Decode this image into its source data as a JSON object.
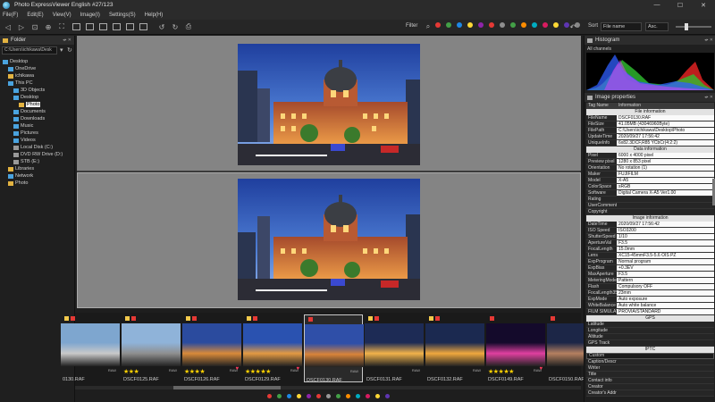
{
  "app": {
    "title": "Photo ExpressViewer English  #27/123",
    "window_buttons": [
      "—",
      "☐",
      "✕"
    ]
  },
  "menu": [
    "File(F)",
    "Edit(E)",
    "View(V)",
    "Image(I)",
    "Settings(S)",
    "Help(H)"
  ],
  "toolbar": {
    "filter_label": "Filter",
    "sort_label": "Sort",
    "sort_value": "File name",
    "order_value": "Asc.",
    "filter_dot_colors": [
      "#e53935",
      "#43a047",
      "#1e88e5",
      "#fdd835",
      "#8e24aa",
      "#e53935",
      "#8e8e8e",
      "#43a047",
      "#fb8c00",
      "#00acc1",
      "#d81b60",
      "#fdd835",
      "#5e35b1",
      "#888888"
    ]
  },
  "left_panel": {
    "title": "Folder",
    "path": "C:\\Users\\ichikawa\\Desk",
    "tree": [
      {
        "label": "Desktop",
        "indent": 0,
        "color": "#4aa3df"
      },
      {
        "label": "OneDrive",
        "indent": 1,
        "color": "#4aa3df"
      },
      {
        "label": "ichikawa",
        "indent": 1,
        "color": "#e3b341"
      },
      {
        "label": "This PC",
        "indent": 1,
        "color": "#4aa3df"
      },
      {
        "label": "3D Objects",
        "indent": 2,
        "color": "#4aa3df"
      },
      {
        "label": "Desktop",
        "indent": 2,
        "color": "#4aa3df"
      },
      {
        "label": "Photo",
        "indent": 3,
        "color": "#e3b341",
        "selected": true
      },
      {
        "label": "Documents",
        "indent": 2,
        "color": "#4aa3df"
      },
      {
        "label": "Downloads",
        "indent": 2,
        "color": "#4aa3df"
      },
      {
        "label": "Music",
        "indent": 2,
        "color": "#4aa3df"
      },
      {
        "label": "Pictures",
        "indent": 2,
        "color": "#4aa3df"
      },
      {
        "label": "Videos",
        "indent": 2,
        "color": "#4aa3df"
      },
      {
        "label": "Local Disk (C:)",
        "indent": 2,
        "color": "#999999"
      },
      {
        "label": "DVD RW Drive (D:)",
        "indent": 2,
        "color": "#999999"
      },
      {
        "label": "STB (E:)",
        "indent": 2,
        "color": "#999999"
      },
      {
        "label": "Libraries",
        "indent": 1,
        "color": "#e3b341"
      },
      {
        "label": "Network",
        "indent": 1,
        "color": "#4aa3df"
      },
      {
        "label": "Photo",
        "indent": 1,
        "color": "#e3b341"
      }
    ]
  },
  "filmstrip": [
    {
      "caption": "0130.RAF",
      "stars": 0,
      "raw": "RAW",
      "heart": false,
      "marks": [
        "#f2c94c",
        "#e53935"
      ],
      "selected": false,
      "scene": "day"
    },
    {
      "caption": "DSCF0125.RAF",
      "stars": 3,
      "raw": "RAW",
      "heart": false,
      "marks": [
        "#f2c94c",
        "#e53935"
      ],
      "selected": false,
      "scene": "city"
    },
    {
      "caption": "DSCF0126.RAF",
      "stars": 4,
      "raw": "RAW",
      "heart": true,
      "marks": [
        "#f2c94c",
        "#e53935"
      ],
      "selected": false,
      "scene": "dusk"
    },
    {
      "caption": "DSCF0129.RAF",
      "stars": 5,
      "raw": "RAW",
      "heart": true,
      "marks": [
        "#f2c94c",
        "#e53935"
      ],
      "selected": false,
      "scene": "dusk2"
    },
    {
      "caption": "DSCF0130.RAF",
      "stars": 0,
      "raw": "RAW",
      "heart": false,
      "marks": [
        "#e53935"
      ],
      "selected": true,
      "scene": "dusk3"
    },
    {
      "caption": "DSCF0131.RAF",
      "stars": 0,
      "raw": "RAW",
      "heart": false,
      "marks": [
        "#f2c94c",
        "#e53935"
      ],
      "selected": false,
      "scene": "night"
    },
    {
      "caption": "DSCF0132.RAF",
      "stars": 0,
      "raw": "RAW",
      "heart": false,
      "marks": [
        "#f2c94c",
        "#e53935"
      ],
      "selected": false,
      "scene": "night2"
    },
    {
      "caption": "DSCF0149.RAF",
      "stars": 5,
      "raw": "RAW",
      "heart": true,
      "marks": [
        "#e53935"
      ],
      "selected": false,
      "scene": "pink"
    },
    {
      "caption": "DSCF0150.RAF",
      "stars": 0,
      "raw": "RAW",
      "heart": false,
      "marks": [
        "#e53935"
      ],
      "selected": false,
      "scene": "street"
    }
  ],
  "status_dot_colors": [
    "#e53935",
    "#43a047",
    "#1e88e5",
    "#fdd835",
    "#8e24aa",
    "#e53935",
    "#999999",
    "#43a047",
    "#fb8c00",
    "#00acc1",
    "#d81b60",
    "#fdd835",
    "#5e35b1"
  ],
  "histogram": {
    "title": "Histogram",
    "subtitle": "All channels"
  },
  "properties": {
    "title": "Image properties",
    "col_tag": "Tag Name",
    "col_info": "Information",
    "sections": [
      {
        "title": "File information",
        "rows": [
          [
            "FileName",
            "DSCF0130.RAF"
          ],
          [
            "FileSize",
            "41.05MB (43046960Byte)"
          ],
          [
            "FilePath",
            "C:\\Users\\ichikawa\\Desktop\\Photo"
          ],
          [
            "UpdateTime",
            "2020/09/27 17:56:42"
          ],
          [
            "UniqueInfo",
            "6x82.3DCF,R85 YCbCr(4:2:2)"
          ]
        ]
      },
      {
        "title": "Data information",
        "rows": [
          [
            "Pixel",
            "6000 x 4000 pixel"
          ],
          [
            "Preview pixel",
            "1280 x 853 pixel"
          ],
          [
            "Orientation",
            "No rotation (1)"
          ],
          [
            "Maker",
            "FUJIFILM"
          ],
          [
            "Model",
            "X-A5"
          ],
          [
            "ColorSpace",
            "sRGB"
          ],
          [
            "Software",
            "Digital Camera X-A5 Ver1.00"
          ],
          [
            "Rating",
            ""
          ],
          [
            "UserComment",
            ""
          ],
          [
            "Copyright",
            ""
          ]
        ]
      },
      {
        "title": "Image information",
        "rows": [
          [
            "DateTime",
            "2020/09/27 17:56:42"
          ],
          [
            "ISO Speed",
            "ISO3200"
          ],
          [
            "ShutterSpeed",
            "1/10"
          ],
          [
            "ApertureVal",
            "F3.5"
          ],
          [
            "FocalLength",
            "15.0mm"
          ],
          [
            "Lens",
            "XC15-45mmF3.5-5.6 OIS PZ"
          ],
          [
            "ExpProgram",
            "Normal program"
          ],
          [
            "ExpBias",
            "+0.3EV"
          ],
          [
            "MaxAperture",
            "F3.5"
          ],
          [
            "MeteringMode",
            "Pattern"
          ],
          [
            "Flash",
            "Compulsory OFF"
          ],
          [
            "FocalLength35",
            "23mm"
          ],
          [
            "ExpMode",
            "Auto exposure"
          ],
          [
            "WhiteBalance",
            "Auto white balance"
          ],
          [
            "FILM SIMULATION",
            "PROVIA/STANDARD"
          ]
        ]
      },
      {
        "title": "GPS",
        "rows": [
          [
            "Latitude",
            ""
          ],
          [
            "Longitude",
            ""
          ],
          [
            "Altitude",
            ""
          ],
          [
            "GPS Track",
            ""
          ]
        ]
      },
      {
        "title": "IPTC",
        "custom": "Custom",
        "rows": [
          [
            "Caption/Descr",
            ""
          ],
          [
            "Writer",
            ""
          ],
          [
            "Title",
            ""
          ],
          [
            "Contact info",
            ""
          ],
          [
            "Creator",
            ""
          ],
          [
            "Creator's Addre",
            ""
          ]
        ]
      }
    ]
  }
}
